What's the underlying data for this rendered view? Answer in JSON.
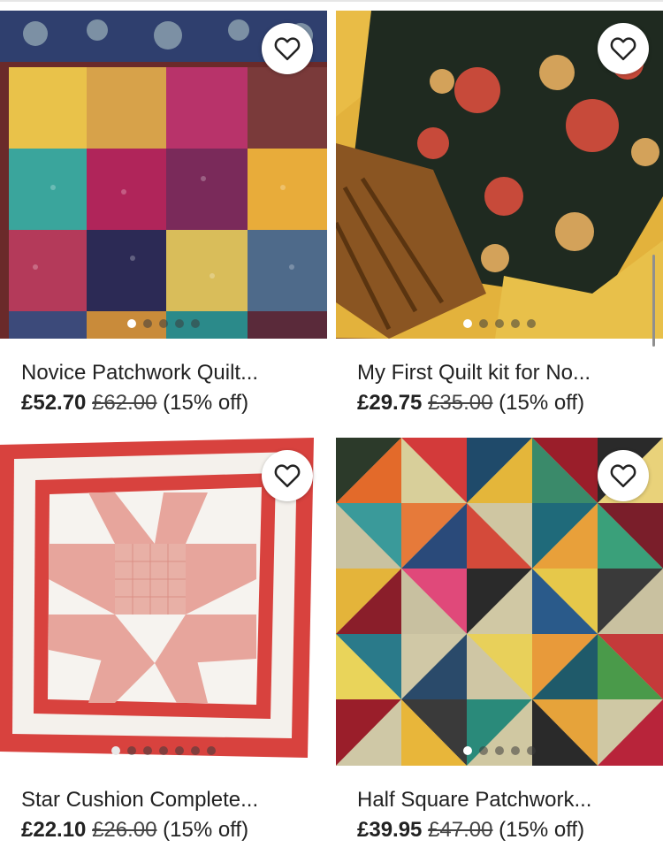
{
  "products": [
    {
      "title": "Novice Patchwork Quilt...",
      "price": "£52.70",
      "original_price": "£62.00",
      "discount": "(15% off)",
      "image_dots": 5,
      "active_dot": 0,
      "favorite_icon": "heart-outline-icon"
    },
    {
      "title": "My First Quilt kit  for No...",
      "price": "£29.75",
      "original_price": "£35.00",
      "discount": "(15% off)",
      "image_dots": 5,
      "active_dot": 0,
      "favorite_icon": "heart-outline-icon"
    },
    {
      "title": "Star Cushion Complete...",
      "price": "£22.10",
      "original_price": "£26.00",
      "discount": "(15% off)",
      "image_dots": 7,
      "active_dot": 0,
      "favorite_icon": "heart-outline-icon"
    },
    {
      "title": "Half Square Patchwork...",
      "price": "£39.95",
      "original_price": "£47.00",
      "discount": "(15% off)",
      "image_dots": 5,
      "active_dot": 0,
      "favorite_icon": "heart-outline-icon"
    }
  ]
}
